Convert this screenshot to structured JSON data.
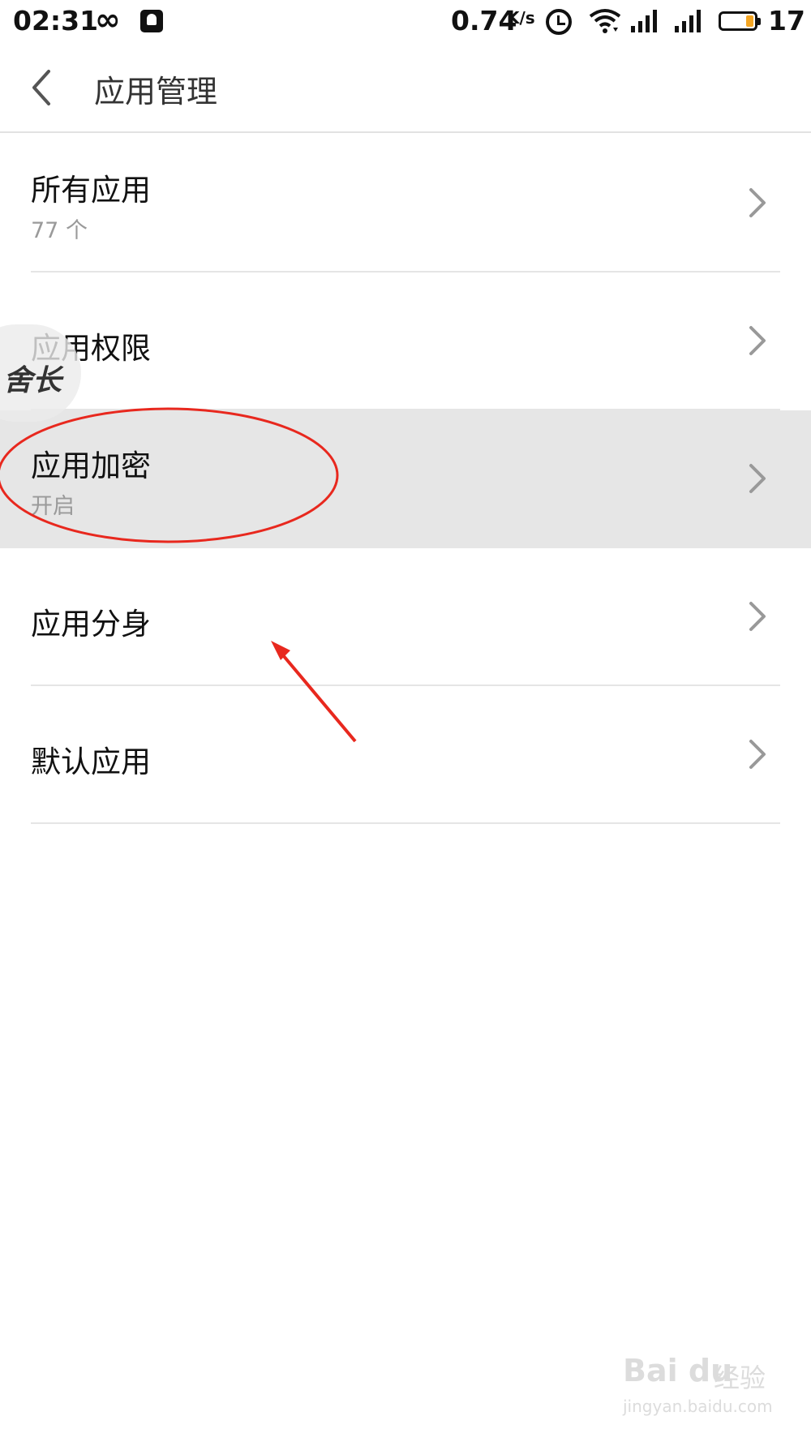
{
  "status_bar": {
    "time": "02:31",
    "infinity_symbol": "∞",
    "speed_value": "0.74",
    "speed_unit": "K/s",
    "battery_percent": "17",
    "battery_color": "#f5a623"
  },
  "header": {
    "title": "应用管理"
  },
  "list": {
    "items": [
      {
        "title": "所有应用",
        "subtitle": "77 个"
      },
      {
        "title": "应用权限",
        "subtitle": ""
      },
      {
        "title": "应用加密",
        "subtitle": "开启"
      },
      {
        "title": "应用分身",
        "subtitle": ""
      },
      {
        "title": "默认应用",
        "subtitle": ""
      }
    ]
  },
  "annotations": {
    "watermark_text": "舍长",
    "baidu_logo_text": "Bai du",
    "baidu_jingyan_text": "经验",
    "baidu_url": "jingyan.baidu.com",
    "circle_color": "#e8281e",
    "arrow_color": "#e8281e"
  },
  "colors": {
    "highlight_row": "#e6e6e6",
    "divider": "#e5e5e5",
    "subtitle": "#9a9a9a",
    "chevron": "#999999"
  }
}
